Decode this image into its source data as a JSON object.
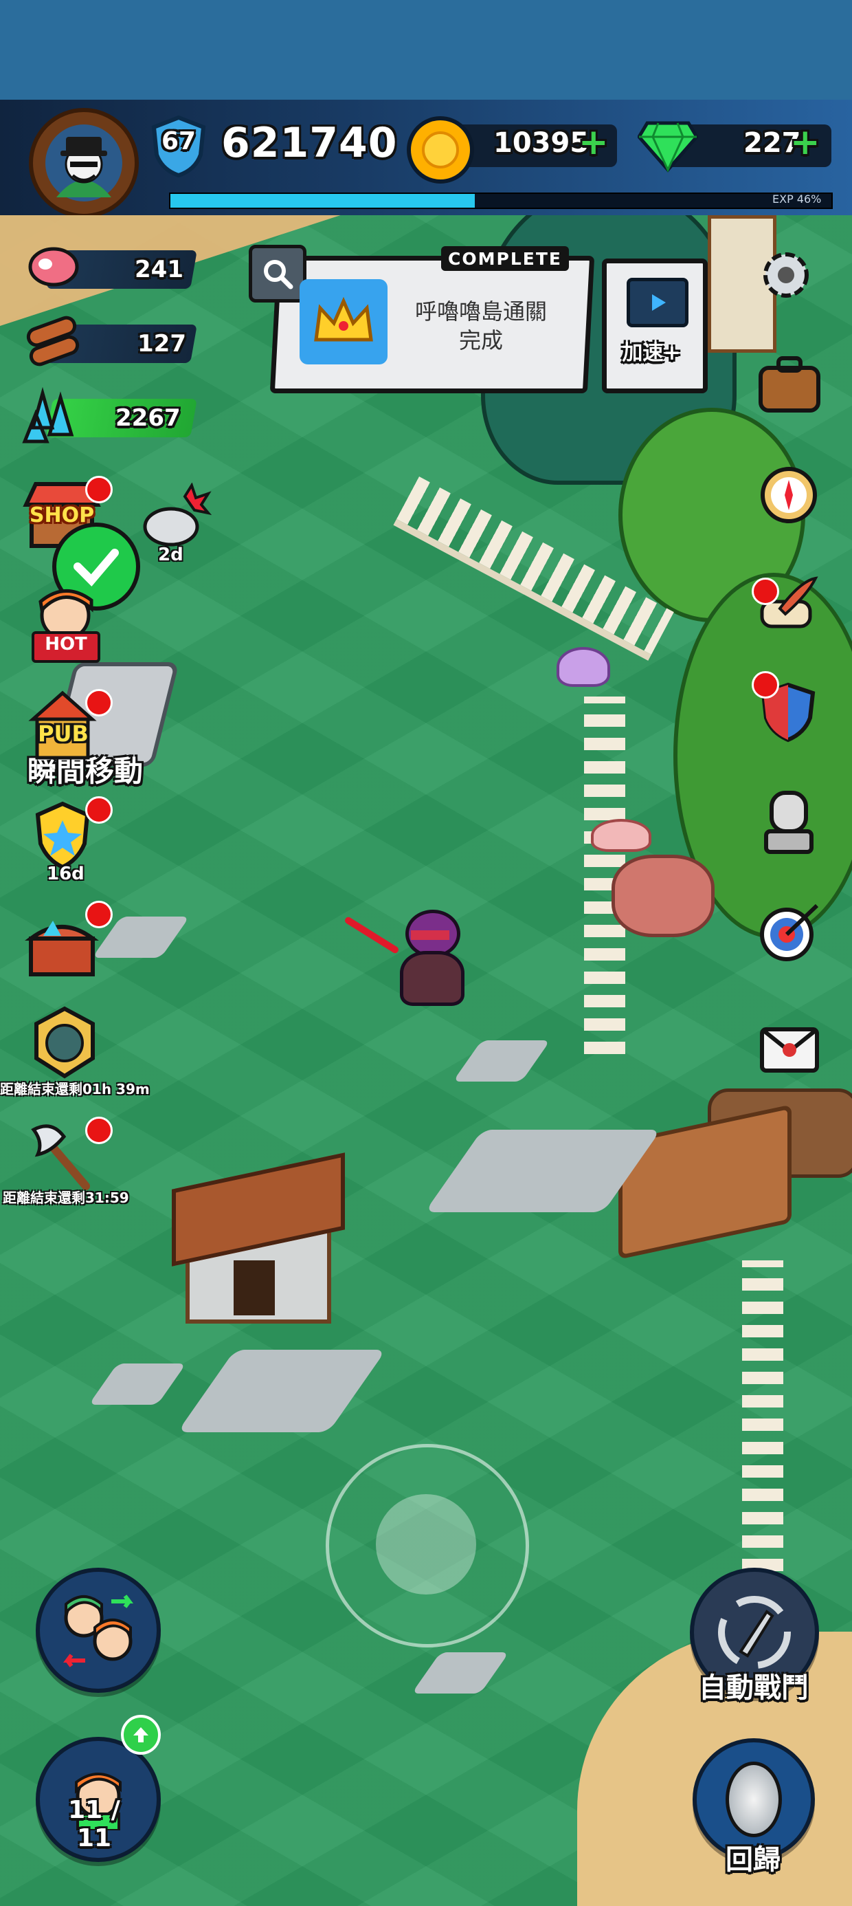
{
  "player": {
    "level": "67",
    "power": "621740",
    "gold": "10395",
    "gems": "227",
    "exp_label": "EXP 46%",
    "exp_progress": 0.46
  },
  "resources": {
    "meat": "241",
    "wood": "127",
    "crystal": "2267"
  },
  "quest": {
    "status": "COMPLETE",
    "text_line1": "呼嚕嚕島通關",
    "text_line2": "完成"
  },
  "speedup": {
    "label": "加速+"
  },
  "left_menu": {
    "shop": "SHOP",
    "hot": "HOT",
    "pub": "PUB",
    "slime_timer": "2d",
    "teleport": "瞬間移動",
    "badge_timer": "16d",
    "event_timer": "距離結束還剩01h 39m",
    "axe_timer": "距離結束還剩31:59"
  },
  "bottom": {
    "auto_battle": "自動戰鬥",
    "return": "回歸",
    "team_count": "11 / 11"
  },
  "colors": {
    "grass": "#2f9a5f",
    "notify": "#e81414",
    "exp_bar": "#27c8ef",
    "crystal_bar": "#37d44a"
  }
}
